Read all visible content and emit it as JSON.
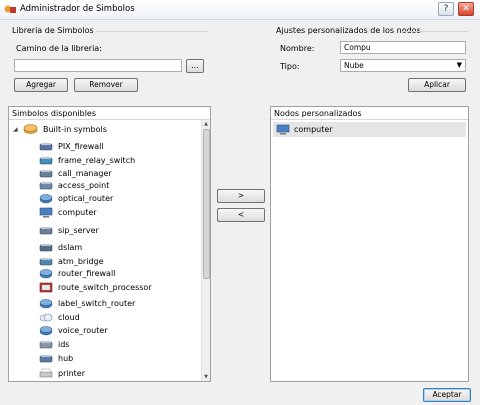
{
  "window": {
    "title": "Administrador de Simbolos"
  },
  "titlebar_buttons": {
    "help": "?",
    "close": "✕"
  },
  "library": {
    "heading": "Libreria de Simbolos",
    "path_label": "Camino de la libreria:",
    "path_value": "",
    "browse_label": "...",
    "add_label": "Agregar",
    "remove_label": "Remover"
  },
  "node_settings": {
    "heading": "Ajustes personalizados de los nodos",
    "name_label": "Nombre:",
    "name_value": "Compu",
    "type_label": "Tipo:",
    "type_value": "Nube",
    "apply_label": "Aplicar"
  },
  "available": {
    "heading": "Simbolos disponibles",
    "root_label": "Built-in symbols",
    "items": [
      {
        "label": "PIX_firewall",
        "icon": "firewall-icon"
      },
      {
        "label": "frame_relay_switch",
        "icon": "switch-icon"
      },
      {
        "label": "call_manager",
        "icon": "server-icon"
      },
      {
        "label": "access_point",
        "icon": "access-point-icon"
      },
      {
        "label": "optical_router",
        "icon": "router-icon"
      },
      {
        "label": "computer",
        "icon": "computer-icon"
      },
      {
        "label": "sip_server",
        "icon": "server-icon"
      },
      {
        "label": "dslam",
        "icon": "dslam-icon"
      },
      {
        "label": "atm_bridge",
        "icon": "bridge-icon"
      },
      {
        "label": "router_firewall",
        "icon": "router-icon"
      },
      {
        "label": "route_switch_processor",
        "icon": "processor-icon"
      },
      {
        "label": "label_switch_router",
        "icon": "router-icon"
      },
      {
        "label": "cloud",
        "icon": "cloud-icon"
      },
      {
        "label": "voice_router",
        "icon": "router-icon"
      },
      {
        "label": "ids",
        "icon": "ids-icon"
      },
      {
        "label": "hub",
        "icon": "hub-icon"
      },
      {
        "label": "printer",
        "icon": "printer-icon"
      }
    ]
  },
  "transfer": {
    "add_arrow": ">",
    "remove_arrow": "<"
  },
  "custom_nodes": {
    "heading": "Nodos personalizados",
    "items": [
      {
        "label": "computer",
        "icon": "computer-icon"
      }
    ]
  },
  "footer": {
    "accept_label": "Aceptar"
  }
}
